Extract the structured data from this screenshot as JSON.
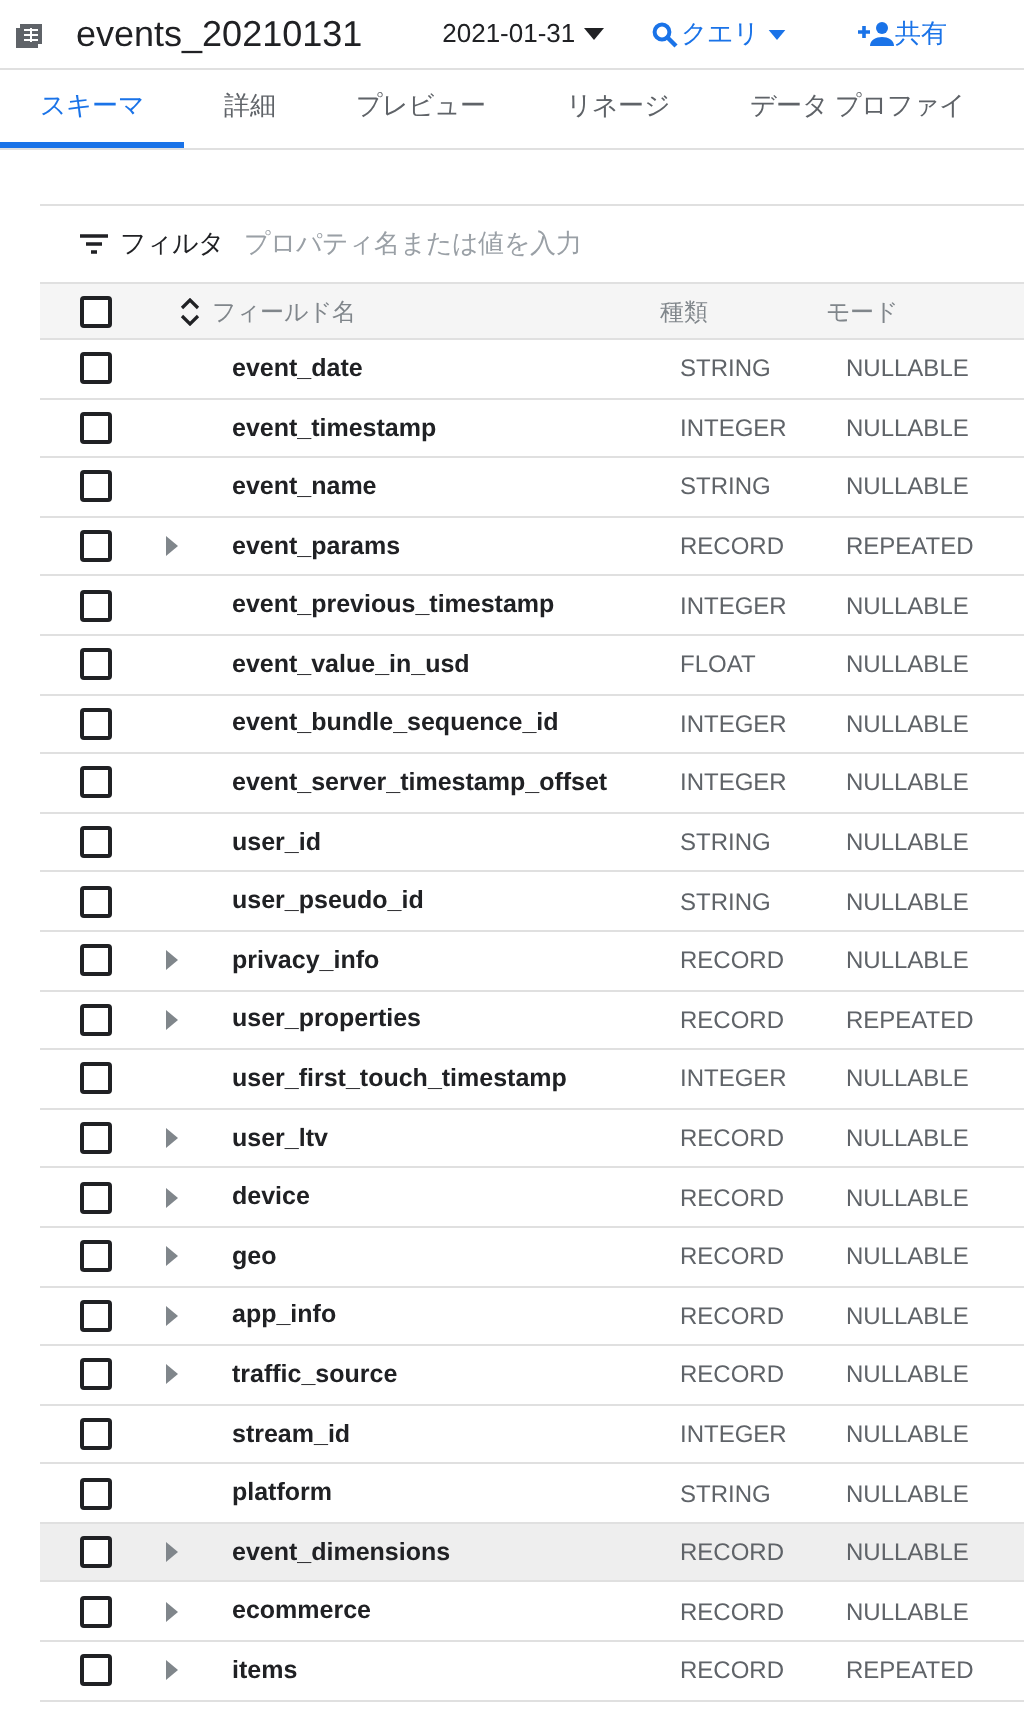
{
  "header": {
    "title": "events_20210131",
    "date": "2021-01-31",
    "query": "クエリ",
    "share": "共有"
  },
  "tabs": [
    {
      "label": "スキーマ",
      "selected": true
    },
    {
      "label": "詳細",
      "selected": false
    },
    {
      "label": "プレビュー",
      "selected": false
    },
    {
      "label": "リネージ",
      "selected": false
    },
    {
      "label": "データ プロファイ",
      "selected": false
    }
  ],
  "filter": {
    "label": "フィルタ",
    "placeholder": "プロパティ名または値を入力"
  },
  "table": {
    "columns": [
      "フィールド名",
      "種類",
      "モード"
    ],
    "all_checked": false,
    "rows": [
      {
        "name": "event_date",
        "type": "STRING",
        "mode": "NULLABLE",
        "expandable": false,
        "checked": false,
        "highlighted": false
      },
      {
        "name": "event_timestamp",
        "type": "INTEGER",
        "mode": "NULLABLE",
        "expandable": false,
        "checked": false,
        "highlighted": false
      },
      {
        "name": "event_name",
        "type": "STRING",
        "mode": "NULLABLE",
        "expandable": false,
        "checked": false,
        "highlighted": false
      },
      {
        "name": "event_params",
        "type": "RECORD",
        "mode": "REPEATED",
        "expandable": true,
        "checked": false,
        "highlighted": false
      },
      {
        "name": "event_previous_timestamp",
        "type": "INTEGER",
        "mode": "NULLABLE",
        "expandable": false,
        "checked": false,
        "highlighted": false
      },
      {
        "name": "event_value_in_usd",
        "type": "FLOAT",
        "mode": "NULLABLE",
        "expandable": false,
        "checked": false,
        "highlighted": false
      },
      {
        "name": "event_bundle_sequence_id",
        "type": "INTEGER",
        "mode": "NULLABLE",
        "expandable": false,
        "checked": false,
        "highlighted": false
      },
      {
        "name": "event_server_timestamp_offset",
        "type": "INTEGER",
        "mode": "NULLABLE",
        "expandable": false,
        "checked": false,
        "highlighted": false
      },
      {
        "name": "user_id",
        "type": "STRING",
        "mode": "NULLABLE",
        "expandable": false,
        "checked": false,
        "highlighted": false
      },
      {
        "name": "user_pseudo_id",
        "type": "STRING",
        "mode": "NULLABLE",
        "expandable": false,
        "checked": false,
        "highlighted": false
      },
      {
        "name": "privacy_info",
        "type": "RECORD",
        "mode": "NULLABLE",
        "expandable": true,
        "checked": false,
        "highlighted": false
      },
      {
        "name": "user_properties",
        "type": "RECORD",
        "mode": "REPEATED",
        "expandable": true,
        "checked": false,
        "highlighted": false
      },
      {
        "name": "user_first_touch_timestamp",
        "type": "INTEGER",
        "mode": "NULLABLE",
        "expandable": false,
        "checked": false,
        "highlighted": false
      },
      {
        "name": "user_ltv",
        "type": "RECORD",
        "mode": "NULLABLE",
        "expandable": true,
        "checked": false,
        "highlighted": false
      },
      {
        "name": "device",
        "type": "RECORD",
        "mode": "NULLABLE",
        "expandable": true,
        "checked": false,
        "highlighted": false
      },
      {
        "name": "geo",
        "type": "RECORD",
        "mode": "NULLABLE",
        "expandable": true,
        "checked": false,
        "highlighted": false
      },
      {
        "name": "app_info",
        "type": "RECORD",
        "mode": "NULLABLE",
        "expandable": true,
        "checked": false,
        "highlighted": false
      },
      {
        "name": "traffic_source",
        "type": "RECORD",
        "mode": "NULLABLE",
        "expandable": true,
        "checked": false,
        "highlighted": false
      },
      {
        "name": "stream_id",
        "type": "INTEGER",
        "mode": "NULLABLE",
        "expandable": false,
        "checked": false,
        "highlighted": false
      },
      {
        "name": "platform",
        "type": "STRING",
        "mode": "NULLABLE",
        "expandable": false,
        "checked": false,
        "highlighted": false
      },
      {
        "name": "event_dimensions",
        "type": "RECORD",
        "mode": "NULLABLE",
        "expandable": true,
        "checked": false,
        "highlighted": true
      },
      {
        "name": "ecommerce",
        "type": "RECORD",
        "mode": "NULLABLE",
        "expandable": true,
        "checked": false,
        "highlighted": false
      },
      {
        "name": "items",
        "type": "RECORD",
        "mode": "REPEATED",
        "expandable": true,
        "checked": false,
        "highlighted": false
      }
    ]
  }
}
